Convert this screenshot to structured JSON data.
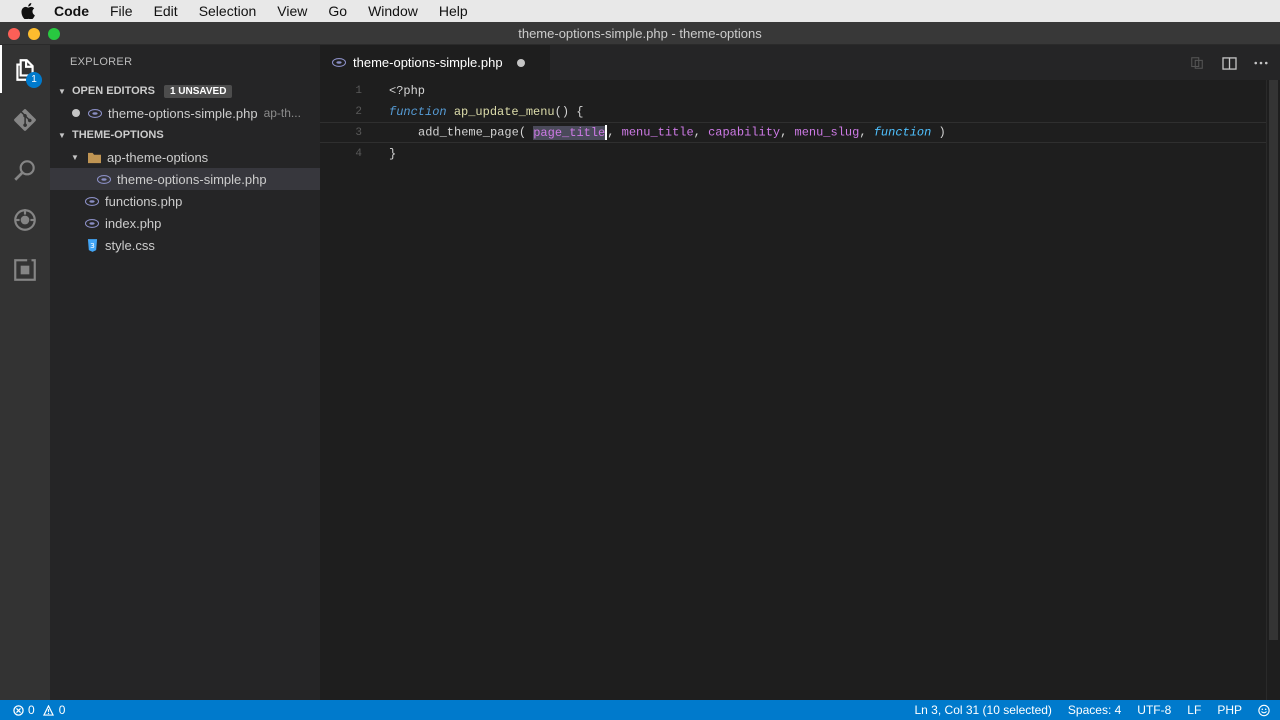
{
  "menubar": {
    "items": [
      "Code",
      "File",
      "Edit",
      "Selection",
      "View",
      "Go",
      "Window",
      "Help"
    ]
  },
  "window": {
    "title": "theme-options-simple.php - theme-options"
  },
  "activity_bar": {
    "icons": [
      "files-icon",
      "git-icon",
      "search-icon",
      "debug-icon",
      "extensions-icon"
    ],
    "explorer_badge": "1"
  },
  "sidebar": {
    "title": "EXPLORER",
    "open_editors": {
      "label": "OPEN EDITORS",
      "badge": "1 UNSAVED",
      "items": [
        {
          "name": "theme-options-simple.php",
          "description": "ap-th..."
        }
      ]
    },
    "project": {
      "label": "THEME-OPTIONS",
      "folder": "ap-theme-options",
      "folder_files": [
        "theme-options-simple.php"
      ],
      "files": [
        {
          "name": "functions.php",
          "type": "php"
        },
        {
          "name": "index.php",
          "type": "php"
        },
        {
          "name": "style.css",
          "type": "css"
        }
      ]
    }
  },
  "editor": {
    "tab_label": "theme-options-simple.php",
    "line_numbers": [
      "1",
      "2",
      "3",
      "4"
    ],
    "code": {
      "line1": "<?php",
      "line2_kw": "function",
      "line2_name": "ap_update_menu",
      "line2_rest": "() {",
      "line3_call": "add_theme_page(",
      "line3_p1": "page_title",
      "line3_p2": "menu_title",
      "line3_p3": "capability",
      "line3_p4": "menu_slug",
      "line3_p5": "function",
      "line3_end": ")",
      "line4": "}"
    }
  },
  "statusbar": {
    "errors": "0",
    "warnings": "0",
    "position": "Ln 3, Col 31 (10 selected)",
    "spaces": "Spaces: 4",
    "encoding": "UTF-8",
    "eol": "LF",
    "language": "PHP"
  },
  "colors": {
    "accent": "#007acc",
    "keyword": "#569cd6",
    "function": "#dcdcaa",
    "parameter": "#ce7ae6"
  }
}
